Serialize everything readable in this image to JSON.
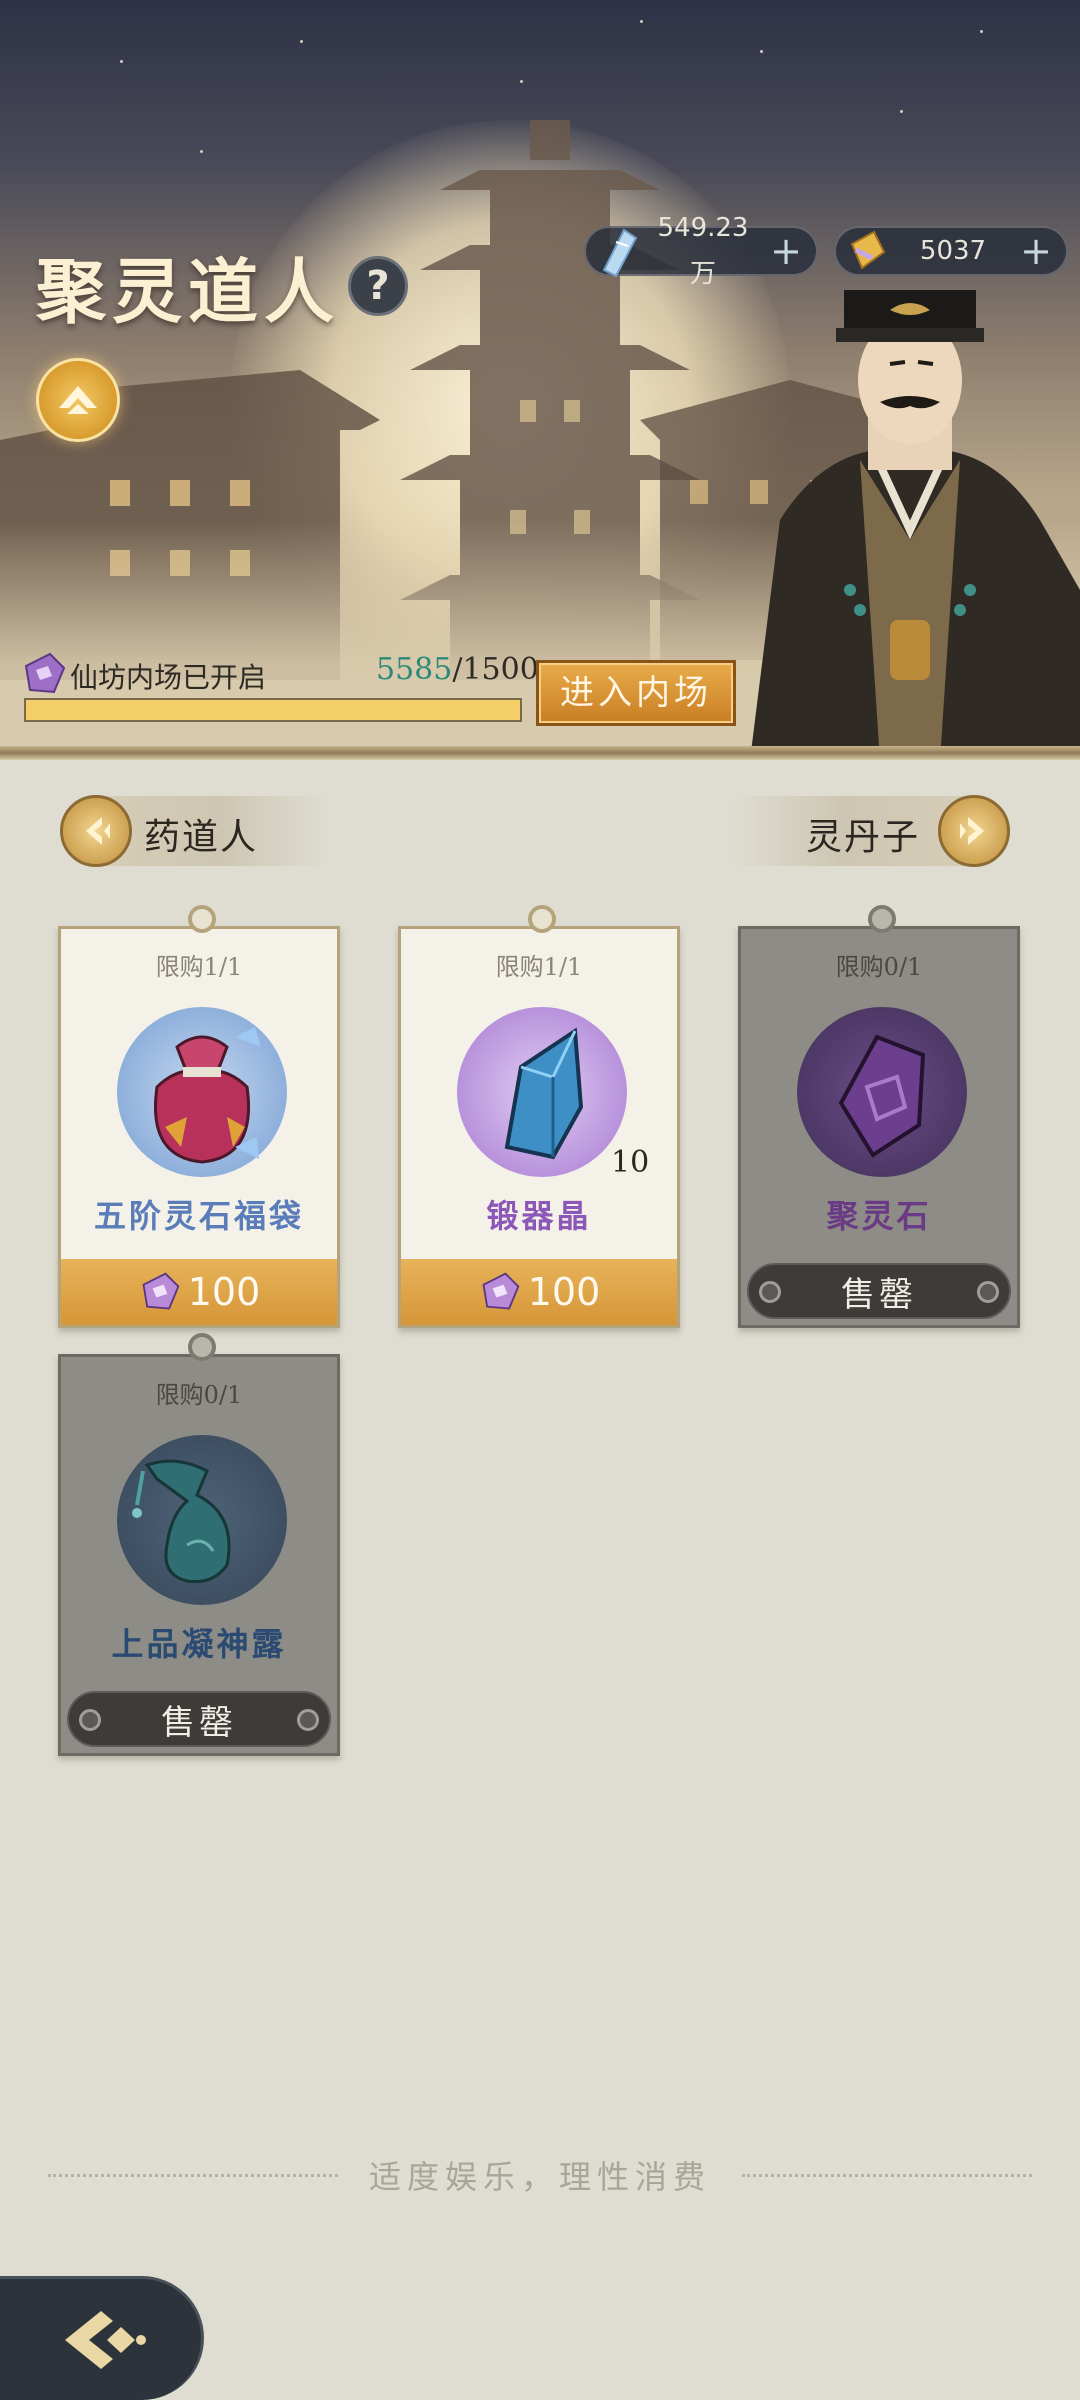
{
  "header": {
    "title": "聚灵道人",
    "help_label": "?",
    "currencies": [
      {
        "icon": "spirit-crystal-icon",
        "value": "549.23万",
        "add_label": "+"
      },
      {
        "icon": "gold-ingot-icon",
        "value": "5037",
        "add_label": "+"
      }
    ],
    "progress": {
      "label": "仙坊内场已开启",
      "current": "5585",
      "separator": "/",
      "target": "1500",
      "fill_fraction": 1.0
    },
    "enter_button": "进入内场"
  },
  "nav": {
    "prev_label": "药道人",
    "next_label": "灵丹子"
  },
  "items": [
    {
      "limit": "限购1/1",
      "name": "五阶灵石福袋",
      "name_color": "#5a7cb8",
      "price": "100",
      "sold_out": false,
      "icon": "lucky-bag-icon",
      "qty": ""
    },
    {
      "limit": "限购1/1",
      "name": "锻器晶",
      "name_color": "#8c58b8",
      "price": "100",
      "sold_out": false,
      "icon": "blue-crystal-icon",
      "qty": "10"
    },
    {
      "limit": "限购0/1",
      "name": "聚灵石",
      "name_color": "#6a3a86",
      "sold_out_label": "售罄",
      "sold_out": true,
      "icon": "purple-spirit-stone-icon",
      "qty": ""
    },
    {
      "limit": "限购0/1",
      "name": "上品凝神露",
      "name_color": "#2a4a72",
      "sold_out_label": "售罄",
      "sold_out": true,
      "icon": "jade-vase-icon",
      "qty": ""
    }
  ],
  "footer": {
    "note": "适度娱乐，理性消费"
  },
  "colors": {
    "gold_accent": "#d59637",
    "progress_current": "#2e8a78",
    "sold_out_card": "#8e8c86"
  }
}
